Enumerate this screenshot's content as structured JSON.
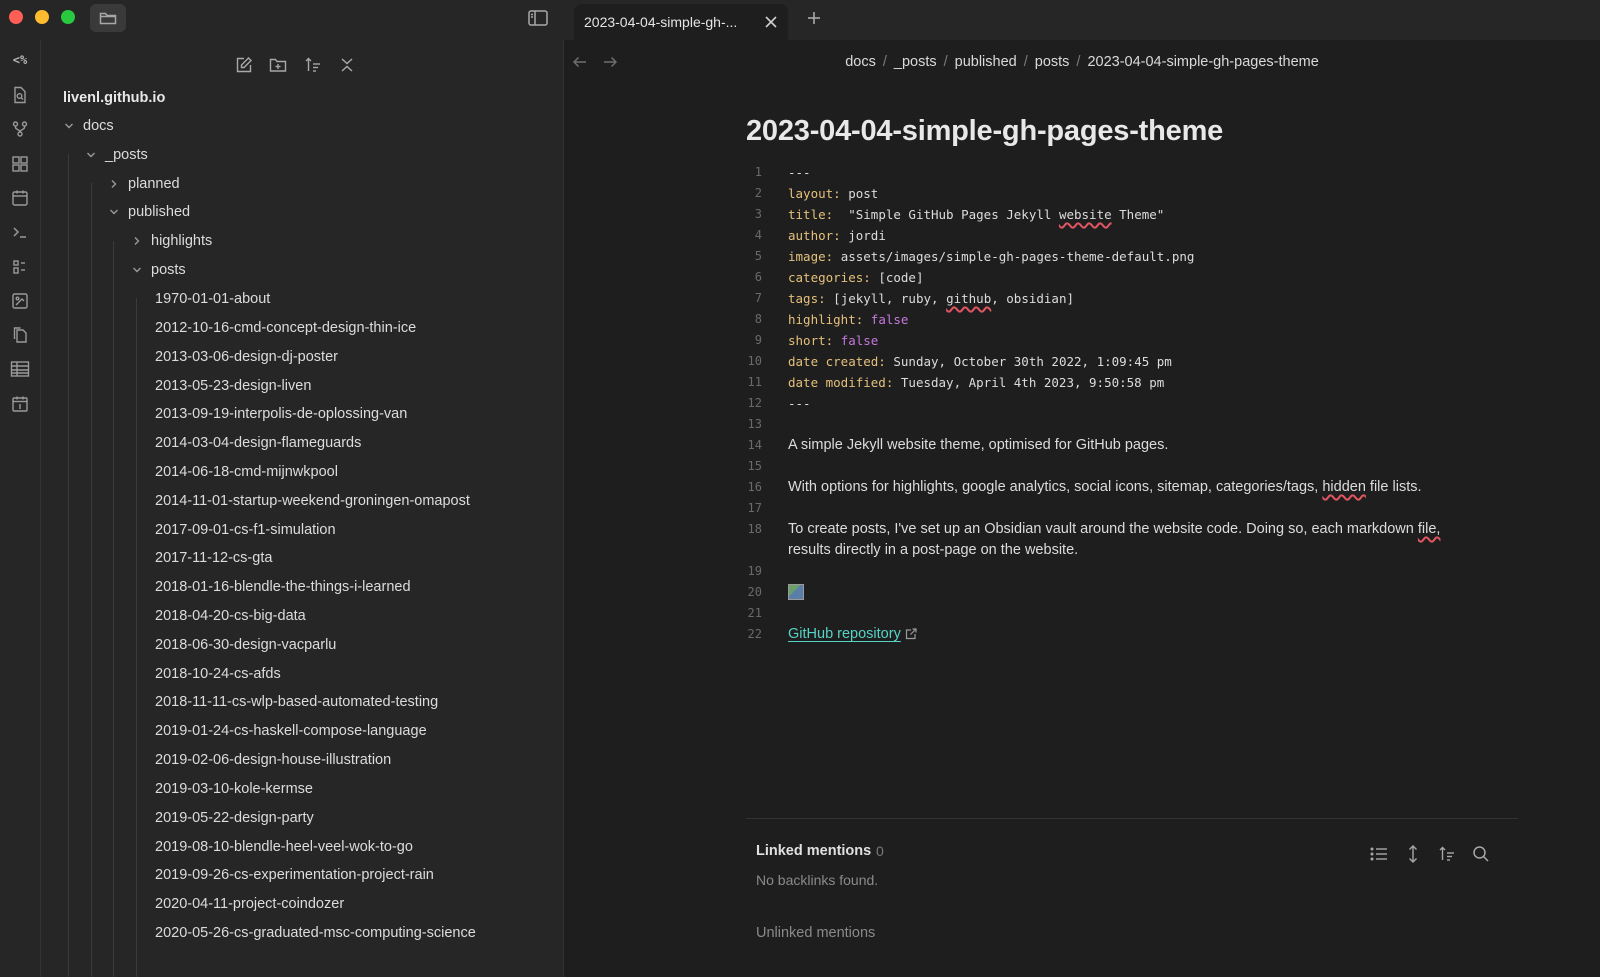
{
  "tab": {
    "title": "2023-04-04-simple-gh-..."
  },
  "ribbon": {
    "items": [
      {
        "icon": "code-icon",
        "label": "<%"
      }
    ]
  },
  "explorer": {
    "vault_name": "livenl.github.io",
    "tree": [
      {
        "label": "docs",
        "state": "expanded",
        "depth": 0
      },
      {
        "label": "_posts",
        "state": "expanded",
        "depth": 1
      },
      {
        "label": "planned",
        "state": "collapsed",
        "depth": 2
      },
      {
        "label": "published",
        "state": "expanded",
        "depth": 2
      },
      {
        "label": "highlights",
        "state": "collapsed",
        "depth": 3
      },
      {
        "label": "posts",
        "state": "expanded",
        "depth": 3
      }
    ],
    "files": [
      "1970-01-01-about",
      "2012-10-16-cmd-concept-design-thin-ice",
      "2013-03-06-design-dj-poster",
      "2013-05-23-design-liven",
      "2013-09-19-interpolis-de-oplossing-van",
      "2014-03-04-design-flameguards",
      "2014-06-18-cmd-mijnwkpool",
      "2014-11-01-startup-weekend-groningen-omapost",
      "2017-09-01-cs-f1-simulation",
      "2017-11-12-cs-gta",
      "2018-01-16-blendle-the-things-i-learned",
      "2018-04-20-cs-big-data",
      "2018-06-30-design-vacparlu",
      "2018-10-24-cs-afds",
      "2018-11-11-cs-wlp-based-automated-testing",
      "2019-01-24-cs-haskell-compose-language",
      "2019-02-06-design-house-illustration",
      "2019-03-10-kole-kermse",
      "2019-05-22-design-party",
      "2019-08-10-blendle-heel-veel-wok-to-go",
      "2019-09-26-cs-experimentation-project-rain",
      "2020-04-11-project-coindozer",
      "2020-05-26-cs-graduated-msc-computing-science"
    ]
  },
  "editor": {
    "breadcrumb": [
      "docs",
      "_posts",
      "published",
      "posts",
      "2023-04-04-simple-gh-pages-theme"
    ],
    "title": "2023-04-04-simple-gh-pages-theme",
    "line_numbers": [
      "1",
      "2",
      "3",
      "4",
      "5",
      "6",
      "7",
      "8",
      "9",
      "10",
      "11",
      "12",
      "13",
      "14",
      "15",
      "16",
      "17",
      "18",
      "19",
      "20",
      "21",
      "22"
    ],
    "frontmatter": {
      "dashes": "---",
      "layout_key": "layout:",
      "layout_val": "post",
      "title_key": "title:",
      "title_val_a": "\"Simple GitHub Pages Jekyll ",
      "title_val_b": "website",
      "title_val_c": " Theme\"",
      "author_key": "author:",
      "author_val": "jordi",
      "image_key": "image:",
      "image_val": "assets/images/simple-gh-pages-theme-default.png",
      "categories_key": "categories:",
      "categories_val": "[code]",
      "tags_key": "tags:",
      "tags_val_a": "[jekyll, ruby, ",
      "tags_val_b": "github",
      "tags_val_c": ", obsidian]",
      "highlight_key": "highlight:",
      "highlight_val": "false",
      "short_key": "short:",
      "short_val": "false",
      "created_key": "date created:",
      "created_val": "Sunday, October 30th 2022, 1:09:45 pm",
      "modified_key": "date modified:",
      "modified_val": "Tuesday, April 4th 2023, 9:50:58 pm"
    },
    "body": {
      "p1": "A simple Jekyll website theme, optimised for GitHub pages.",
      "p2_a": "With options for highlights, google analytics, social icons, sitemap, categories/tags, ",
      "p2_b": "hidden",
      "p2_c": " file lists.",
      "p3_a": "To create posts, I've set up an Obsidian vault around the website code. Doing so, each markdown ",
      "p3_b": "file,",
      "p3_c": "results directly in a post-page on the website.",
      "link": "GitHub repository"
    }
  },
  "backlinks": {
    "linked_title": "Linked mentions",
    "linked_count": "0",
    "empty": "No backlinks found.",
    "unlinked_title": "Unlinked mentions"
  }
}
